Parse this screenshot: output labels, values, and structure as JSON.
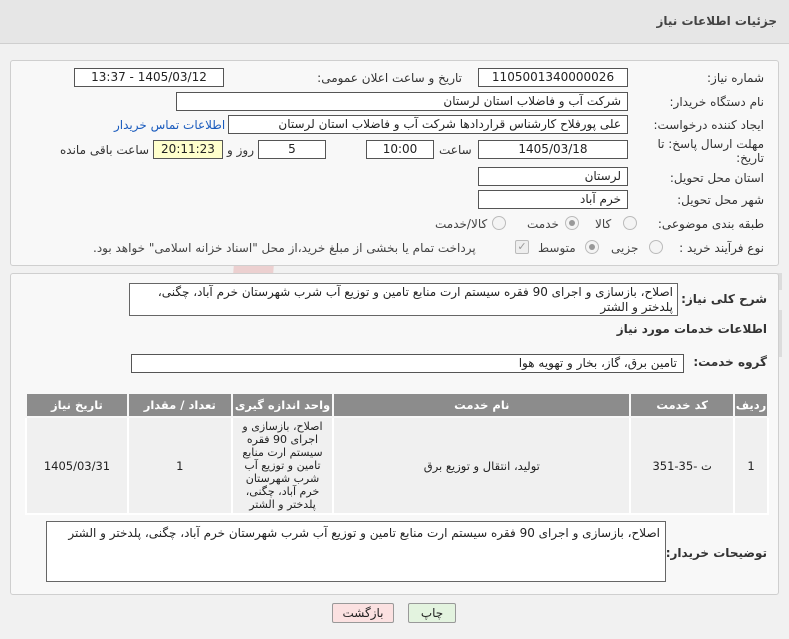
{
  "header": {
    "title": "جزئیات اطلاعات نیاز"
  },
  "form": {
    "need_number_label": "شماره نیاز:",
    "need_number_value": "1105001340000026",
    "announce_label": "تاریخ و ساعت اعلان عمومی:",
    "announce_value": "1405/03/12 - 13:37",
    "buyer_label": "نام دستگاه خریدار:",
    "buyer_value": "شرکت آب و فاضلاب استان لرستان",
    "creator_label": "ایجاد کننده درخواست:",
    "creator_value": "علی پورفلاح کارشناس قراردادها شرکت آب و فاضلاب استان لرستان",
    "contact_link": "اطلاعات تماس خریدار",
    "deadline_label_1": "مهلت ارسال پاسخ: تا",
    "deadline_label_2": "تاریخ:",
    "deadline_date": "1405/03/18",
    "time_label": "ساعت",
    "deadline_time": "10:00",
    "days_value": "5",
    "days_label": "روز و",
    "remaining_time": "20:11:23",
    "remaining_label": "ساعت باقی مانده",
    "province_label": "استان محل تحویل:",
    "province_value": "لرستان",
    "city_label": "شهر محل تحویل:",
    "city_value": "خرم آباد",
    "category_label": "طبقه بندی موضوعی:",
    "category_options": [
      "کالا",
      "خدمت",
      "کالا/خدمت"
    ],
    "category_selected": "خدمت",
    "process_label": "نوع فرآیند خرید :",
    "process_options": [
      "جزیی",
      "متوسط"
    ],
    "process_selected": "متوسط",
    "payment_note": "پرداخت تمام یا بخشی از مبلغ خرید،از محل \"اسناد خزانه اسلامی\" خواهد بود."
  },
  "summary": {
    "label": "شرح کلی نیاز:",
    "value": "اصلاح، بازسازی و اجرای 90 فقره سیستم ارت منابع تامین و توزیع آب شرب شهرستان خرم آباد، چگنی، پلدختر و الشتر"
  },
  "services": {
    "title": "اطلاعات خدمات مورد نیاز",
    "group_label": "گروه خدمت:",
    "group_value": "تامین برق، گاز، بخار و تهویه هوا",
    "columns": [
      "ردیف",
      "کد خدمت",
      "نام خدمت",
      "واحد اندازه گیری",
      "تعداد / مقدار",
      "تاریخ نیاز"
    ],
    "rows": [
      {
        "row": "1",
        "code": "ت -35-351",
        "name": "تولید، انتقال و توزیع برق",
        "unit": "اصلاح، بازسازی و اجرای 90 فقره سیستم ارت منابع تامین و توزیع آب شرب شهرستان خرم آباد، چگنی، پلدختر و الشتر",
        "qty": "1",
        "date": "1405/03/31"
      }
    ]
  },
  "buyer_notes": {
    "label": "توضیحات خریدار:",
    "value": "اصلاح، بازسازی و اجرای 90 فقره سیستم ارت منابع تامین و توزیع آب شرب شهرستان خرم آباد، چگنی، پلدختر و الشتر"
  },
  "buttons": {
    "print": "چاپ",
    "back": "بازگشت"
  },
  "colors": {
    "link": "#1a5bbd",
    "print_bg": "#e3f3df",
    "back_bg": "#fbe1e1",
    "remaining_bg": "#ffffcc"
  }
}
